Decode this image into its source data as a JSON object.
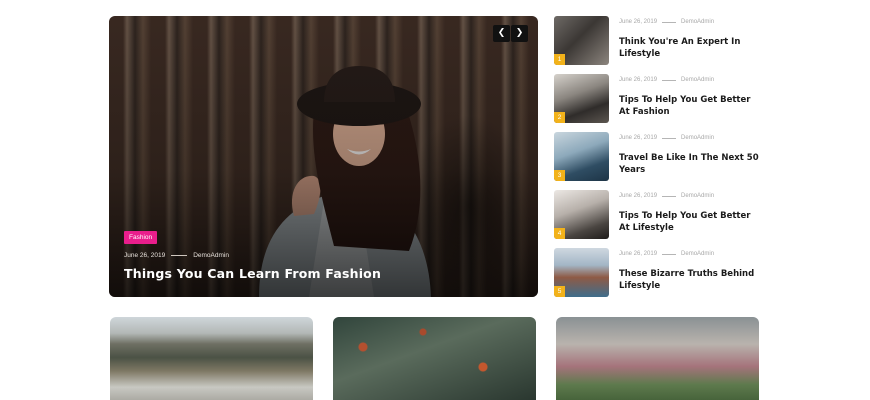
{
  "hero": {
    "category": "Fashion",
    "date": "June 26, 2019",
    "author": "DemoAdmin",
    "title": "Things You Can Learn From Fashion",
    "prev_icon": "chevron-left-icon",
    "next_icon": "chevron-right-icon",
    "badge_color": "#e91e8c"
  },
  "posts": [
    {
      "num": "1",
      "date": "June 26, 2019",
      "author": "DemoAdmin",
      "title": "Think You're An Expert In Lifestyle"
    },
    {
      "num": "2",
      "date": "June 26, 2019",
      "author": "DemoAdmin",
      "title": "Tips To Help You Get Better At Fashion"
    },
    {
      "num": "3",
      "date": "June 26, 2019",
      "author": "DemoAdmin",
      "title": "Travel Be Like In The Next 50 Years"
    },
    {
      "num": "4",
      "date": "June 26, 2019",
      "author": "DemoAdmin",
      "title": "Tips To Help You Get Better At Lifestyle"
    },
    {
      "num": "5",
      "date": "June 26, 2019",
      "author": "DemoAdmin",
      "title": "These Bizarre Truths Behind Lifestyle"
    }
  ],
  "colors": {
    "number_badge": "#f2b21a",
    "title_text": "#1b1b1b",
    "meta_text": "#a8a8a8"
  }
}
